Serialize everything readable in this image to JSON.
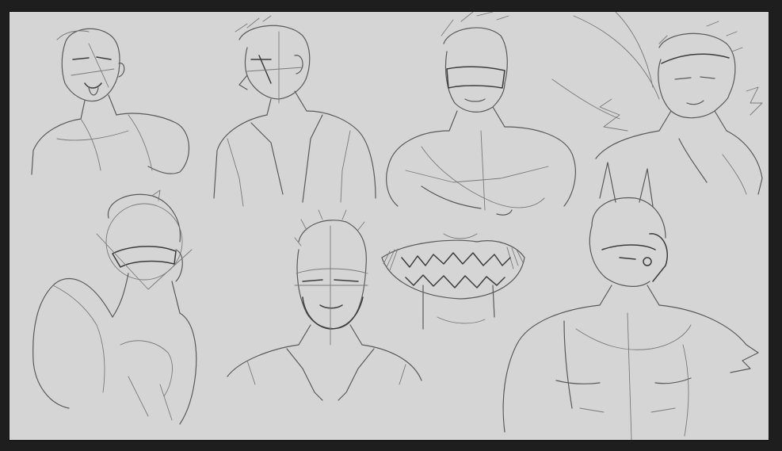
{
  "app": {
    "background_color": "#1e1e1e",
    "canvas_color": "#d5d5d5",
    "stroke_color": "#5a5a5a"
  },
  "artwork": {
    "kind": "sketch-sheet",
    "sketches": [
      {
        "subject": "head-tongue-out"
      },
      {
        "subject": "head-profile-jacket"
      },
      {
        "subject": "head-masked-torso"
      },
      {
        "subject": "head-headband-cape"
      },
      {
        "subject": "masked-back-view"
      },
      {
        "subject": "bearded-man-jacket"
      },
      {
        "subject": "mouth-teeth-study"
      },
      {
        "subject": "dog-mask-torso"
      }
    ]
  }
}
